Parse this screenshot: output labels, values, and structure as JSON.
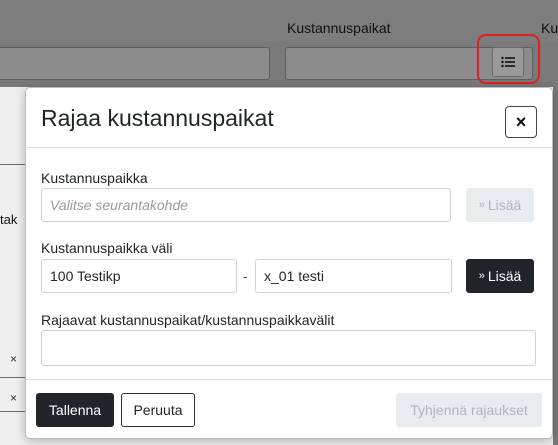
{
  "background": {
    "column_label": "Kustannuspaikat",
    "column_label_cut": "Ku",
    "side_text": "tak",
    "remove_glyph": "×",
    "filter_button_icon": "list-icon",
    "highlight_color": "#e0201f"
  },
  "modal": {
    "title": "Rajaa kustannuspaikat",
    "close_glyph": "×",
    "cost_center": {
      "label": "Kustannuspaikka",
      "placeholder": "Valitse seurantakohde",
      "value": "",
      "add_label": "Lisää",
      "add_icon": "chevron-double-down-icon",
      "add_enabled": false
    },
    "cost_center_range": {
      "label": "Kustannuspaikka väli",
      "from_value": "100 Testikp",
      "separator": "-",
      "to_value": "x_01 testi",
      "add_label": "Lisää",
      "add_icon": "chevron-double-down-icon",
      "add_enabled": true
    },
    "selected": {
      "label": "Rajaavat kustannuspaikat/kustannuspaikkavälit",
      "value": ""
    },
    "footer": {
      "save_label": "Tallenna",
      "cancel_label": "Peruuta",
      "clear_label": "Tyhjennä rajaukset"
    }
  },
  "colors": {
    "dark_button": "#212529",
    "disabled_button": "#e9ecef",
    "border": "#ced4da"
  }
}
